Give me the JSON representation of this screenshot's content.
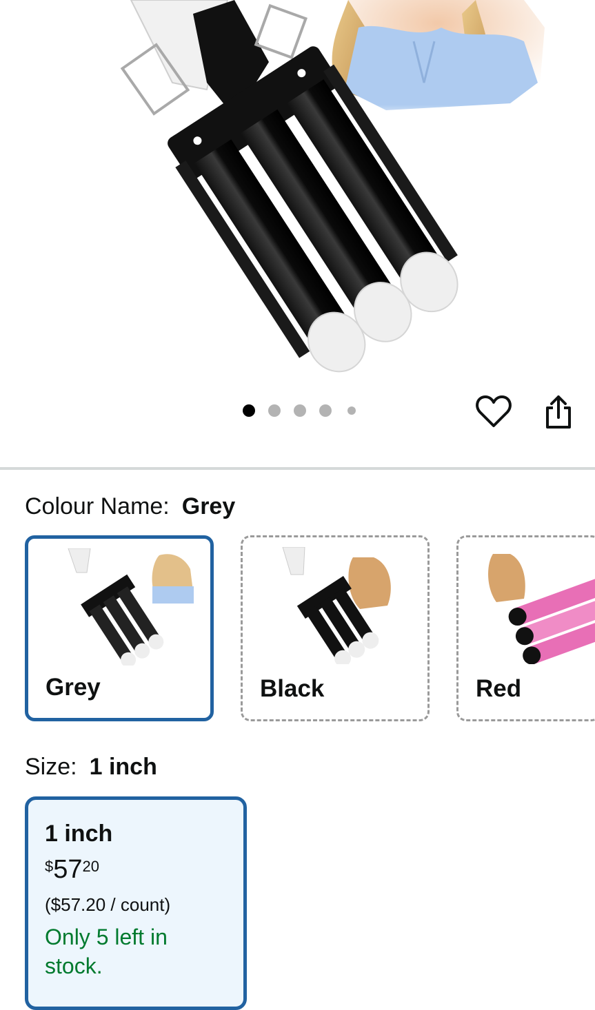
{
  "colour": {
    "label": "Colour Name:",
    "selected": "Grey",
    "options": [
      {
        "name": "Grey"
      },
      {
        "name": "Black"
      },
      {
        "name": "Red"
      }
    ]
  },
  "size": {
    "label": "Size:",
    "selected": "1 inch",
    "card": {
      "name": "1 inch",
      "price_symbol": "$",
      "price_whole": "57",
      "price_fraction": "20",
      "unit_price": "($57.20 / count)",
      "stock_line1": "Only 5 left in",
      "stock_line2": "stock."
    }
  },
  "carousel": {
    "total_images": 5,
    "active_index": 0
  },
  "icons": {
    "wishlist": "heart-icon",
    "share": "share-icon"
  },
  "colors": {
    "accent": "#2162a1",
    "stock_green": "#007a2e",
    "selected_bg": "#edf6fd"
  }
}
